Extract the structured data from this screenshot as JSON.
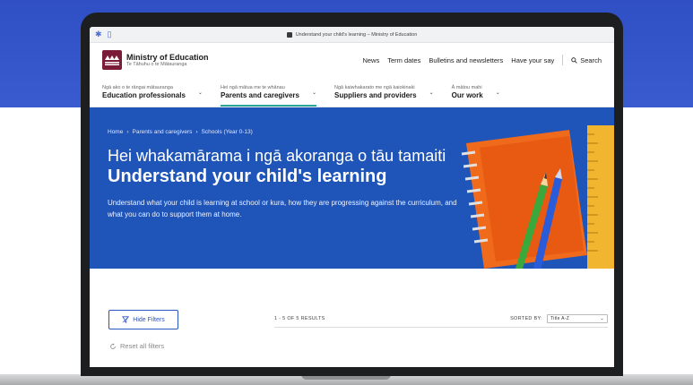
{
  "browser": {
    "tab_title": "Understand your child's learning – Ministry of Education"
  },
  "header": {
    "logo_title": "Ministry of Education",
    "logo_subtitle": "Te Tāhuhu o te Mātauranga",
    "top_links": [
      "News",
      "Term dates",
      "Bulletins and newsletters",
      "Have your say"
    ],
    "search_label": "Search"
  },
  "nav": {
    "items": [
      {
        "small": "Ngā ako o te rāngai mātauranga",
        "label": "Education professionals"
      },
      {
        "small": "Hei ngā mātua me te whānau",
        "label": "Parents and caregivers"
      },
      {
        "small": "Ngā kaiwhakarato me ngā kaiokinaki",
        "label": "Suppliers and providers"
      },
      {
        "small": "Ā mātou mahi",
        "label": "Our work"
      }
    ]
  },
  "hero": {
    "breadcrumb": [
      "Home",
      "Parents and caregivers",
      "Schools (Year 0-13)"
    ],
    "title_mi": "Hei whakamārama i ngā akoranga o tāu tamaiti",
    "title_en": "Understand your child's learning",
    "description": "Understand what your child is learning at school or kura, how they are progressing against the curriculum, and what you can do to support them at home."
  },
  "filters": {
    "hide_label": "Hide Filters",
    "reset_label": "Reset all filters",
    "results_text": "1 - 5 OF 5 RESULTS",
    "sorted_label": "SORTED BY:",
    "sort_value": "Title A-Z"
  },
  "colors": {
    "brand_blue": "#1f55b8",
    "accent_teal": "#2ba59a",
    "logo_maroon": "#7a1c38"
  }
}
